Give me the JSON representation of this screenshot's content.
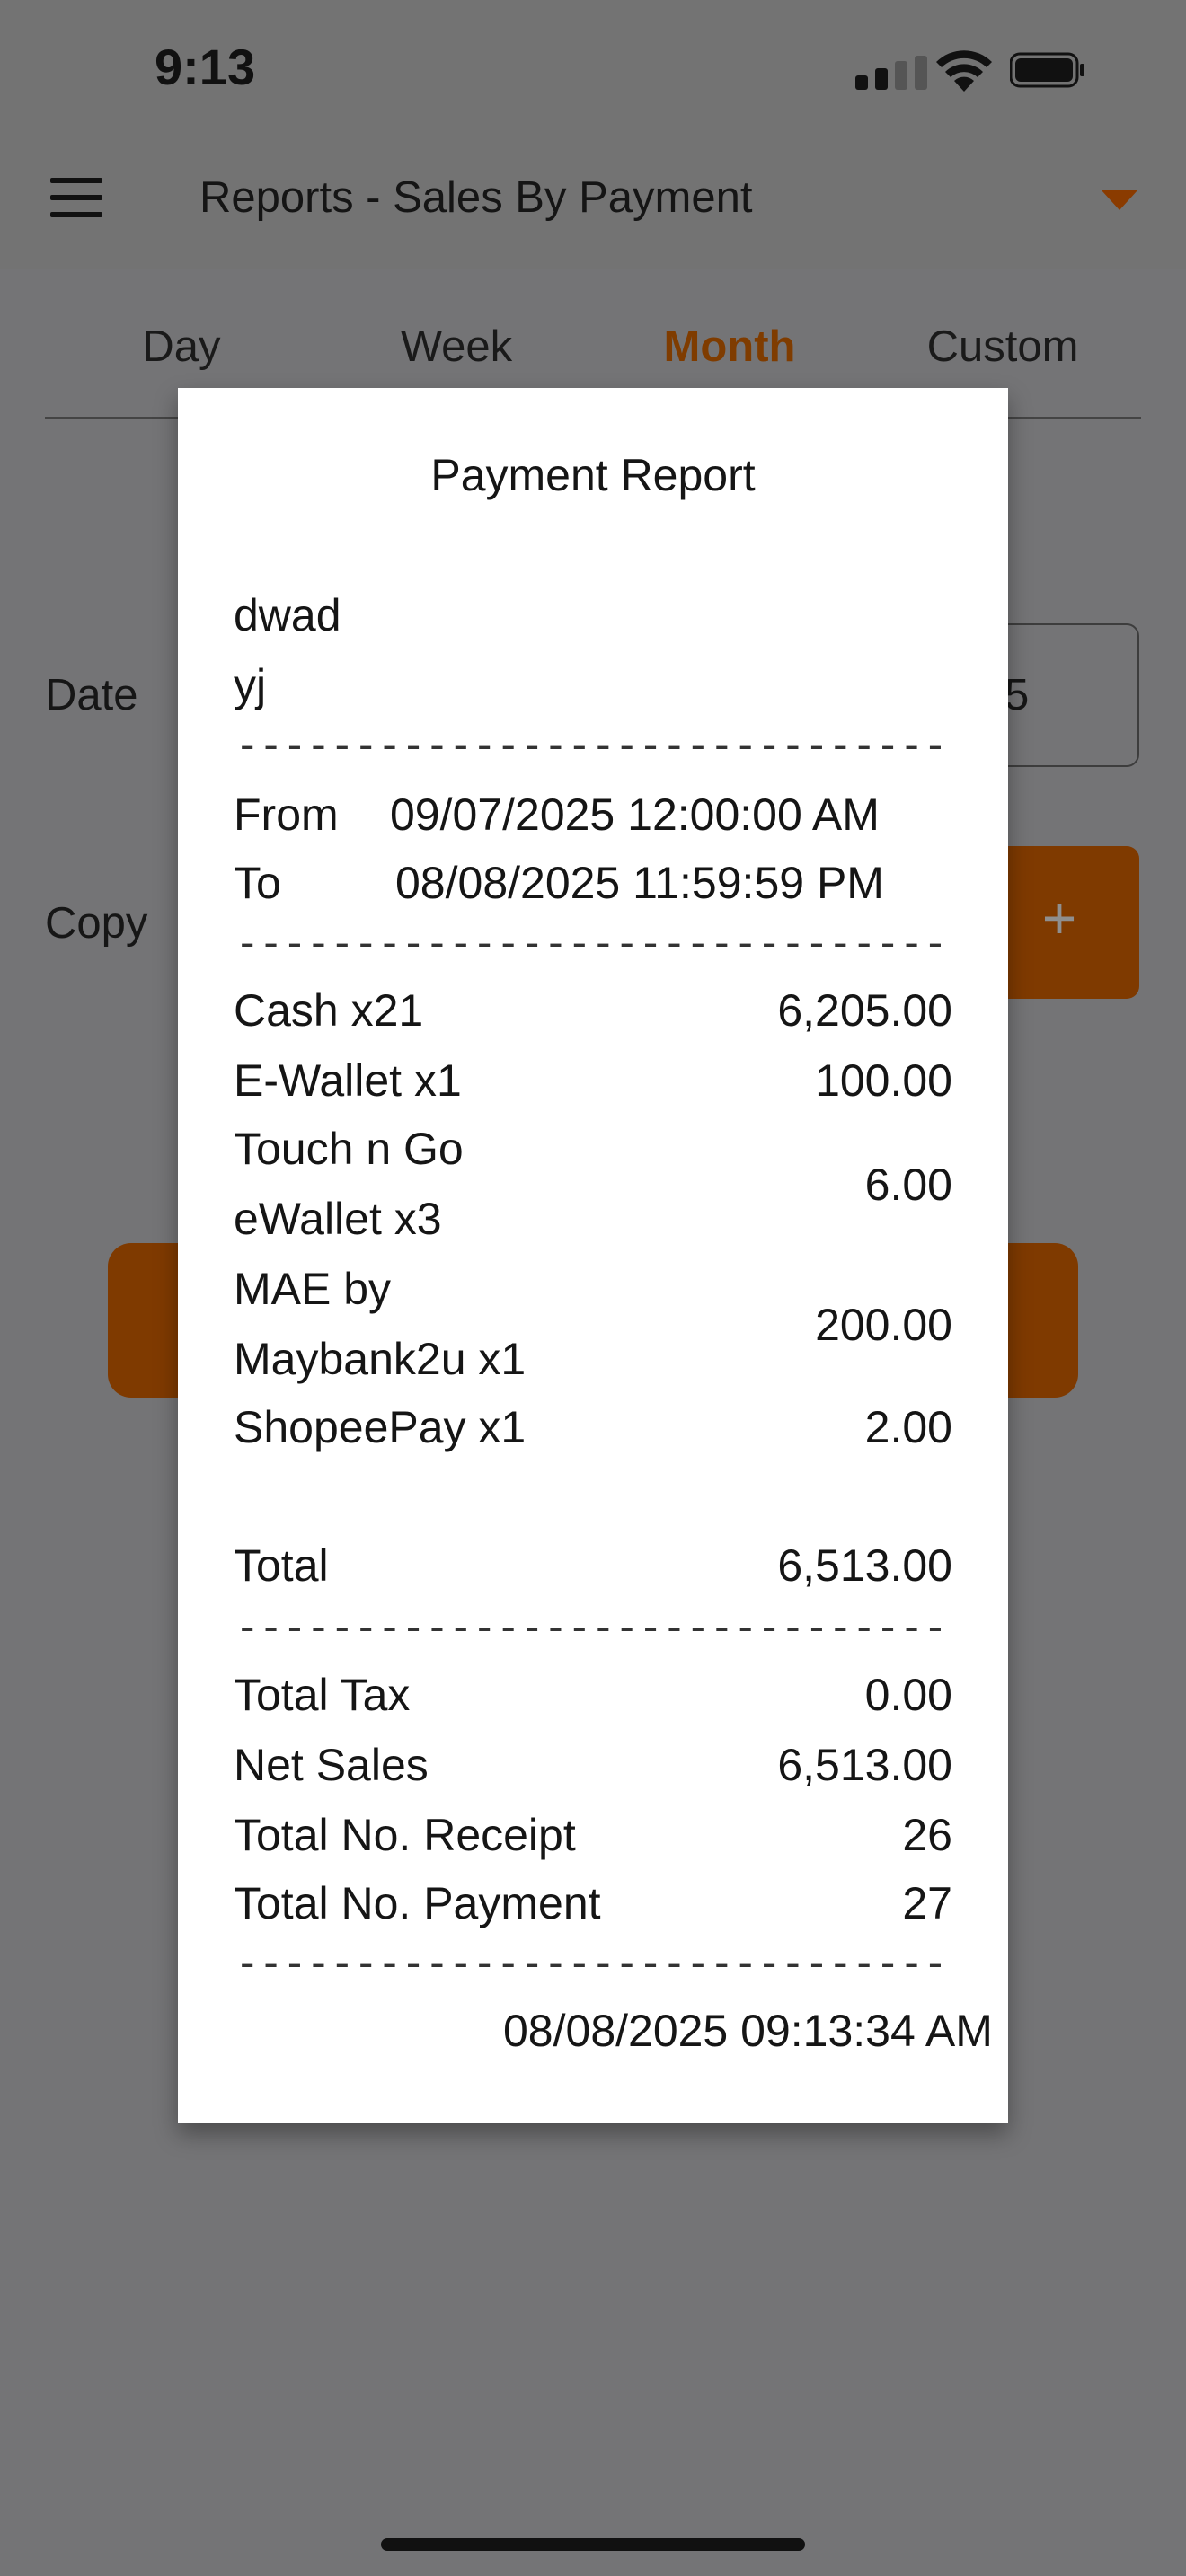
{
  "status_bar": {
    "time": "9:13"
  },
  "header": {
    "title": "Reports - Sales By Payment"
  },
  "tabs": [
    "Day",
    "Week",
    "Month",
    "Custom"
  ],
  "active_tab": "Month",
  "form": {
    "date_label": "Date",
    "copy_label": "Copy",
    "date_value_partial": "5",
    "plus_label": "+"
  },
  "modal": {
    "title": "Payment Report",
    "store_line1": "dwad",
    "store_line2": "yj",
    "separator": "------------------------------------",
    "from_label": "From",
    "from_value": "09/07/2025 12:00:00 AM",
    "to_label": "To",
    "to_value": "08/08/2025 11:59:59 PM",
    "payments": [
      {
        "label_line1": "Cash x21",
        "label_line2": "",
        "amount": "6,205.00"
      },
      {
        "label_line1": "E-Wallet x1",
        "label_line2": "",
        "amount": "100.00"
      },
      {
        "label_line1": "Touch n Go",
        "label_line2": "eWallet x3",
        "amount": "6.00"
      },
      {
        "label_line1": "MAE by",
        "label_line2": "Maybank2u x1",
        "amount": "200.00"
      },
      {
        "label_line1": "ShopeePay x1",
        "label_line2": "",
        "amount": "2.00"
      }
    ],
    "total_label": "Total",
    "total_value": "6,513.00",
    "total_tax_label": "Total Tax",
    "total_tax_value": "0.00",
    "net_sales_label": "Net Sales",
    "net_sales_value": "6,513.00",
    "receipt_label": "Total No. Receipt",
    "receipt_value": "26",
    "payment_count_label": "Total No. Payment",
    "payment_count_value": "27",
    "printed_at": "08/08/2025 09:13:34 AM"
  },
  "colors": {
    "accent": "#7f3a00",
    "overlay": "#747476"
  }
}
